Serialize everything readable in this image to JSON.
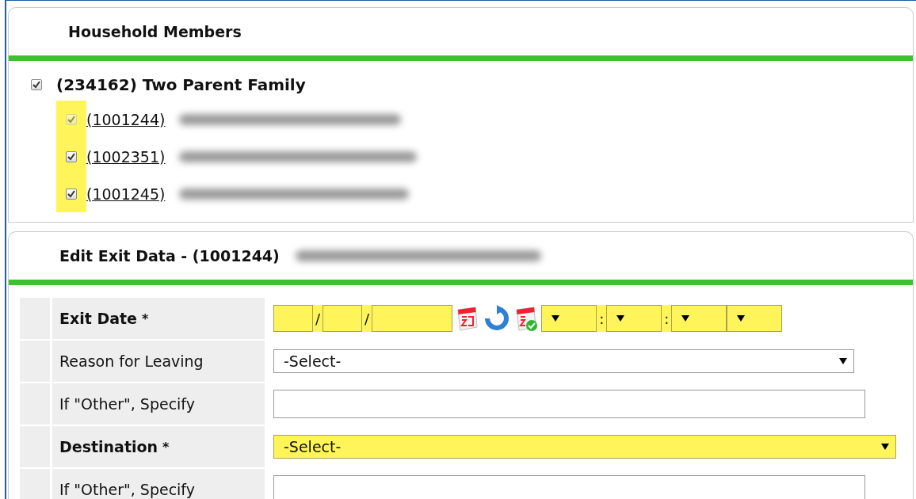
{
  "household": {
    "title": "Household Members",
    "family": {
      "label": "(234162) Two Parent Family",
      "checked": true
    },
    "members": [
      {
        "id": "(1001244)",
        "checked": true,
        "disabled": true,
        "highlighted": true
      },
      {
        "id": "(1002351)",
        "checked": true,
        "disabled": false,
        "highlighted": true
      },
      {
        "id": "(1001245)",
        "checked": true,
        "disabled": false,
        "highlighted": true
      }
    ]
  },
  "exit_form": {
    "title": "Edit Exit Data - (1001244)",
    "rows": [
      {
        "kind": "datetime",
        "label": "Exit Date",
        "marker": "*",
        "required": true,
        "segments": [
          {
            "kind": "input"
          },
          {
            "kind": "sep",
            "text": "/"
          },
          {
            "kind": "input"
          },
          {
            "kind": "sep",
            "text": "/"
          },
          {
            "kind": "input"
          },
          {
            "kind": "icon"
          },
          {
            "kind": "icon"
          },
          {
            "kind": "icon"
          },
          {
            "kind": "select"
          },
          {
            "kind": "sep",
            "text": ":"
          },
          {
            "kind": "select"
          },
          {
            "kind": "sep",
            "text": ":"
          },
          {
            "kind": "select"
          },
          {
            "kind": "select"
          }
        ]
      },
      {
        "kind": "select",
        "label": "Reason for Leaving",
        "required": false,
        "value": "-Select-"
      },
      {
        "kind": "text",
        "label": "If \"Other\", Specify",
        "required": false
      },
      {
        "kind": "select",
        "label": "Destination",
        "marker": "*",
        "required": true,
        "value": "-Select-"
      },
      {
        "kind": "text",
        "label": "If \"Other\", Specify",
        "required": false
      }
    ]
  }
}
